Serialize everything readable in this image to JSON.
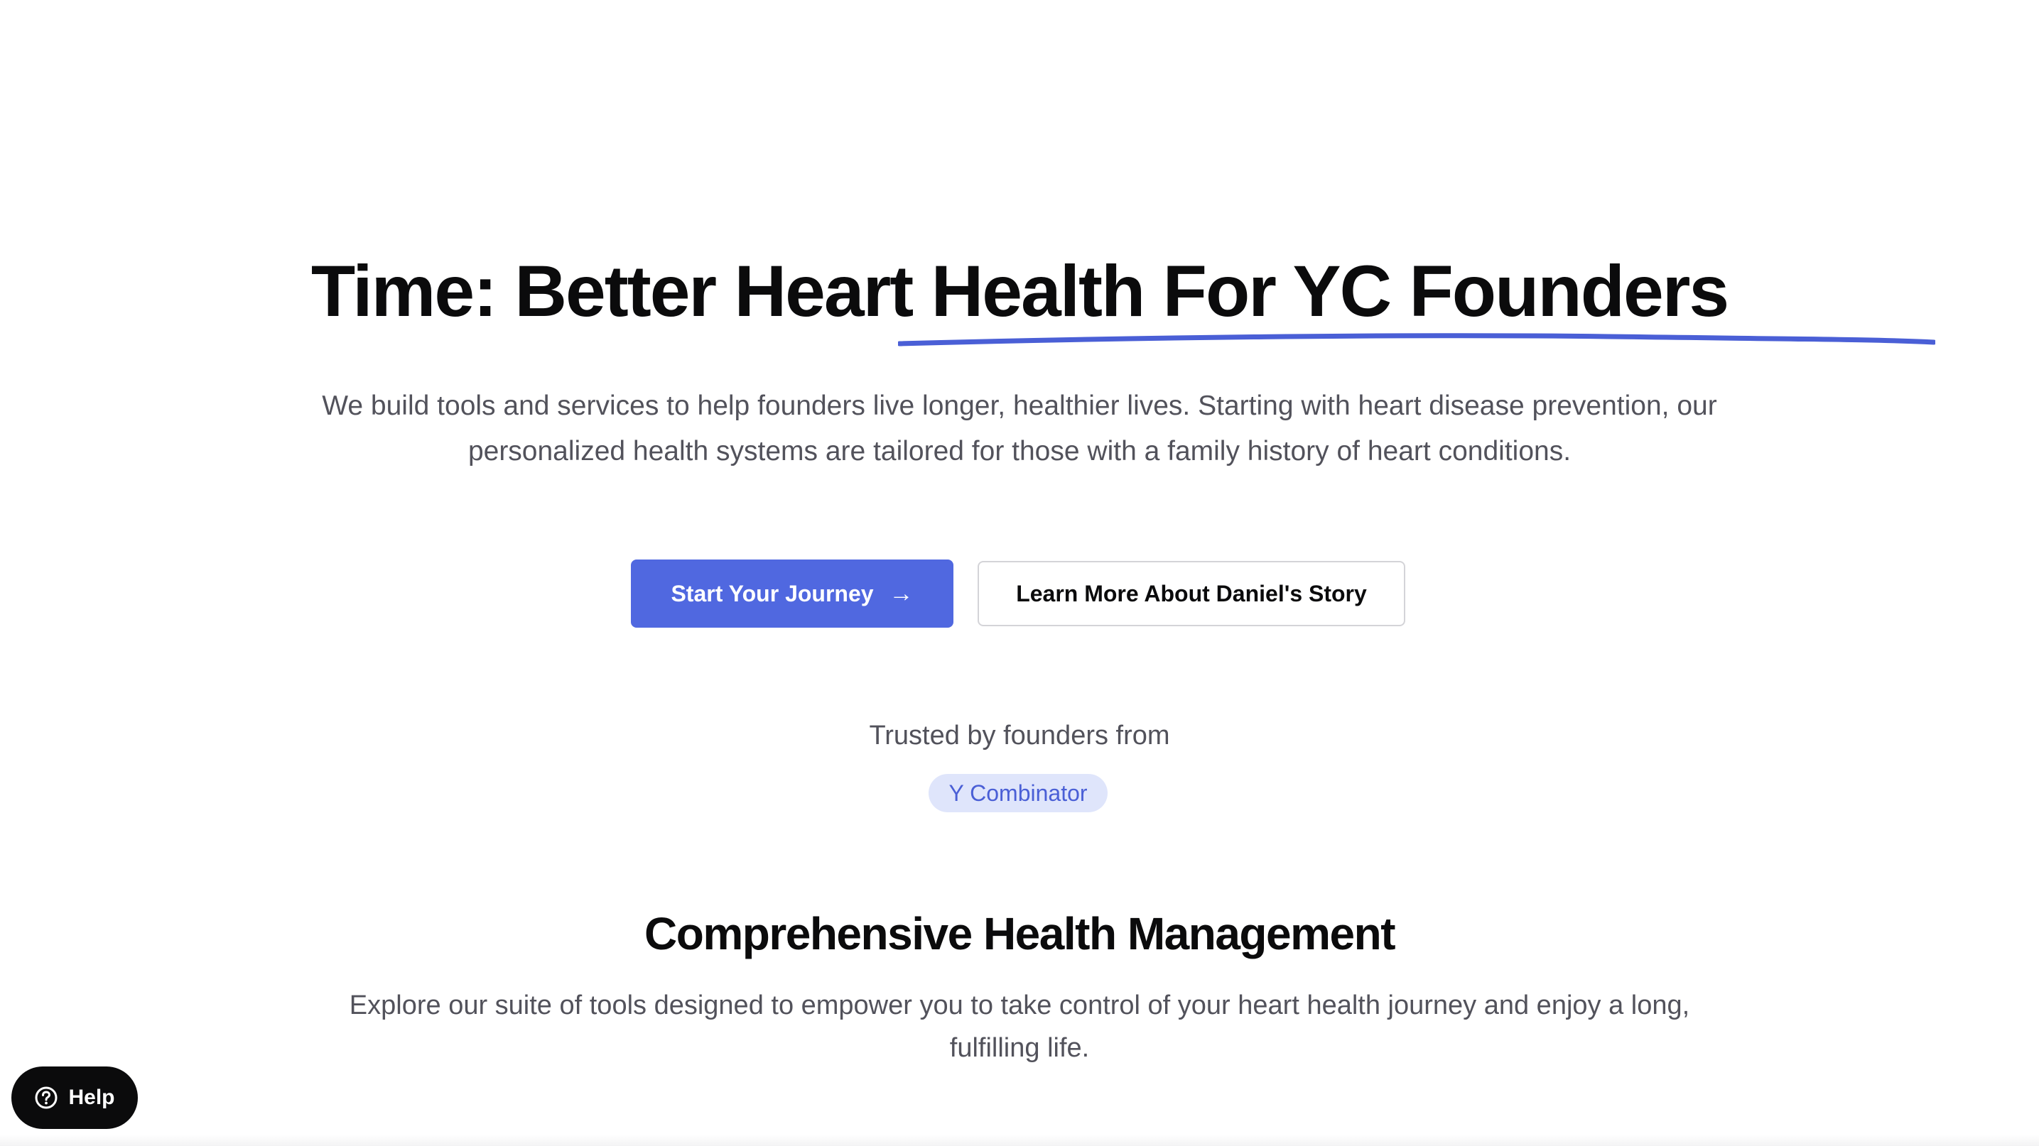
{
  "hero": {
    "title": "Time: Better Heart Health For YC Founders",
    "subtitle": "We build tools and services to help founders live longer, healthier lives. Starting with heart disease prevention, our personalized health systems are tailored for those with a family history of heart conditions.",
    "underline_color": "#4a5fd6"
  },
  "cta": {
    "primary_label": "Start Your Journey",
    "primary_icon": "arrow-right-icon",
    "primary_arrow_glyph": "→",
    "secondary_label": "Learn More About Daniel's Story",
    "primary_color": "#5068e0"
  },
  "trusted": {
    "label": "Trusted by founders from",
    "badge": "Y Combinator"
  },
  "section": {
    "title": "Comprehensive Health Management",
    "subtitle": "Explore our suite of tools designed to empower you to take control of your heart health journey and enjoy a long, fulfilling life."
  },
  "help": {
    "label": "Help",
    "icon": "question-circle-icon"
  }
}
